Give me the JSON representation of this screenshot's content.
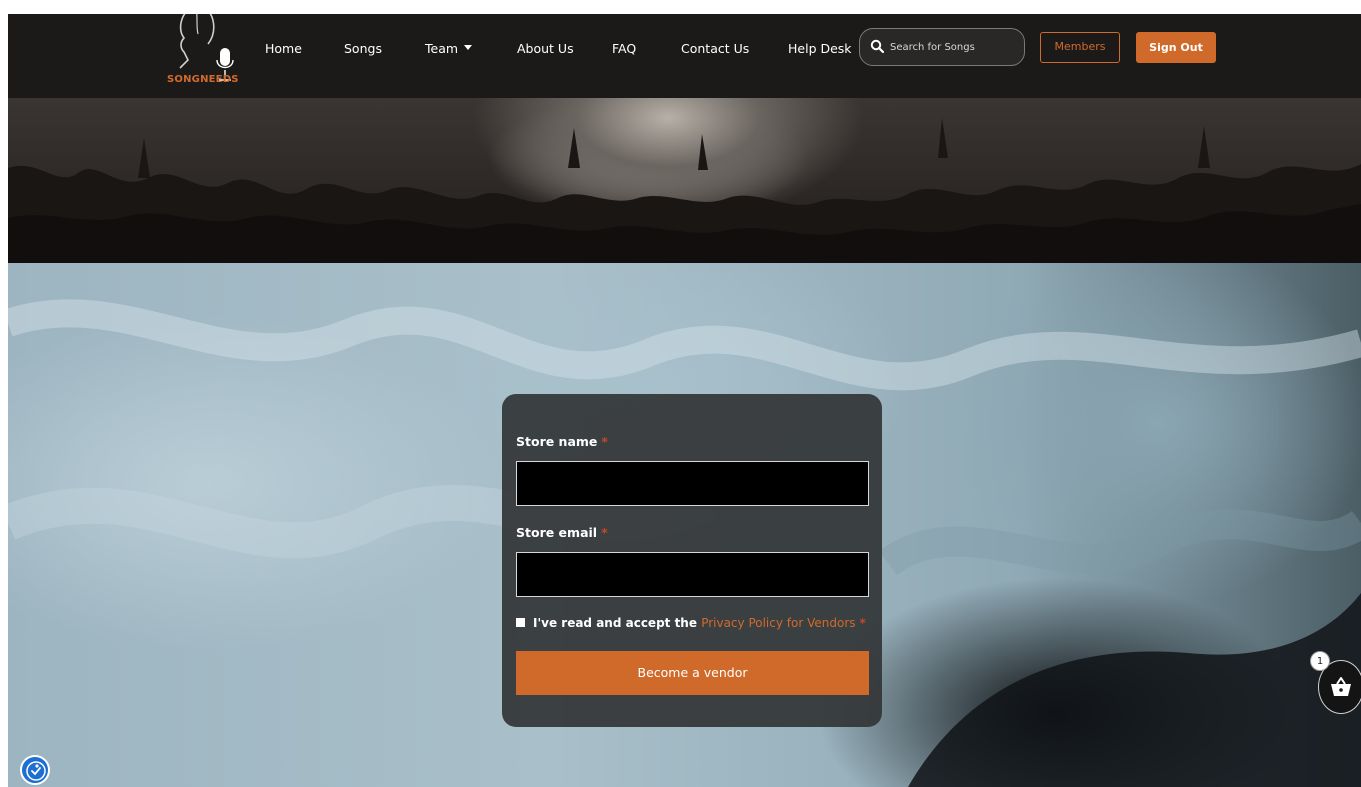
{
  "brand": {
    "name": "SONGNEEDS",
    "accent": "#d16a2c"
  },
  "nav": {
    "items": [
      {
        "label": "Home"
      },
      {
        "label": "Songs"
      },
      {
        "label": "Team"
      },
      {
        "label": "About Us"
      },
      {
        "label": "FAQ"
      },
      {
        "label": "Contact Us"
      },
      {
        "label": "Help Desk"
      }
    ]
  },
  "search": {
    "placeholder": "Search for Songs",
    "icon": "search-icon"
  },
  "header_buttons": {
    "members": "Members",
    "signout": "Sign Out"
  },
  "form": {
    "store_name_label": "Store name",
    "store_email_label": "Store email",
    "required_mark": "*",
    "store_name_value": "",
    "store_email_value": "",
    "consent_text": "I've read and accept the",
    "consent_link": "Privacy Policy for Vendors",
    "consent_checked": false,
    "submit_label": "Become a vendor"
  },
  "cart": {
    "count": "1",
    "icon": "basket-icon"
  },
  "accessibility": {
    "icon": "accessibility-icon"
  }
}
